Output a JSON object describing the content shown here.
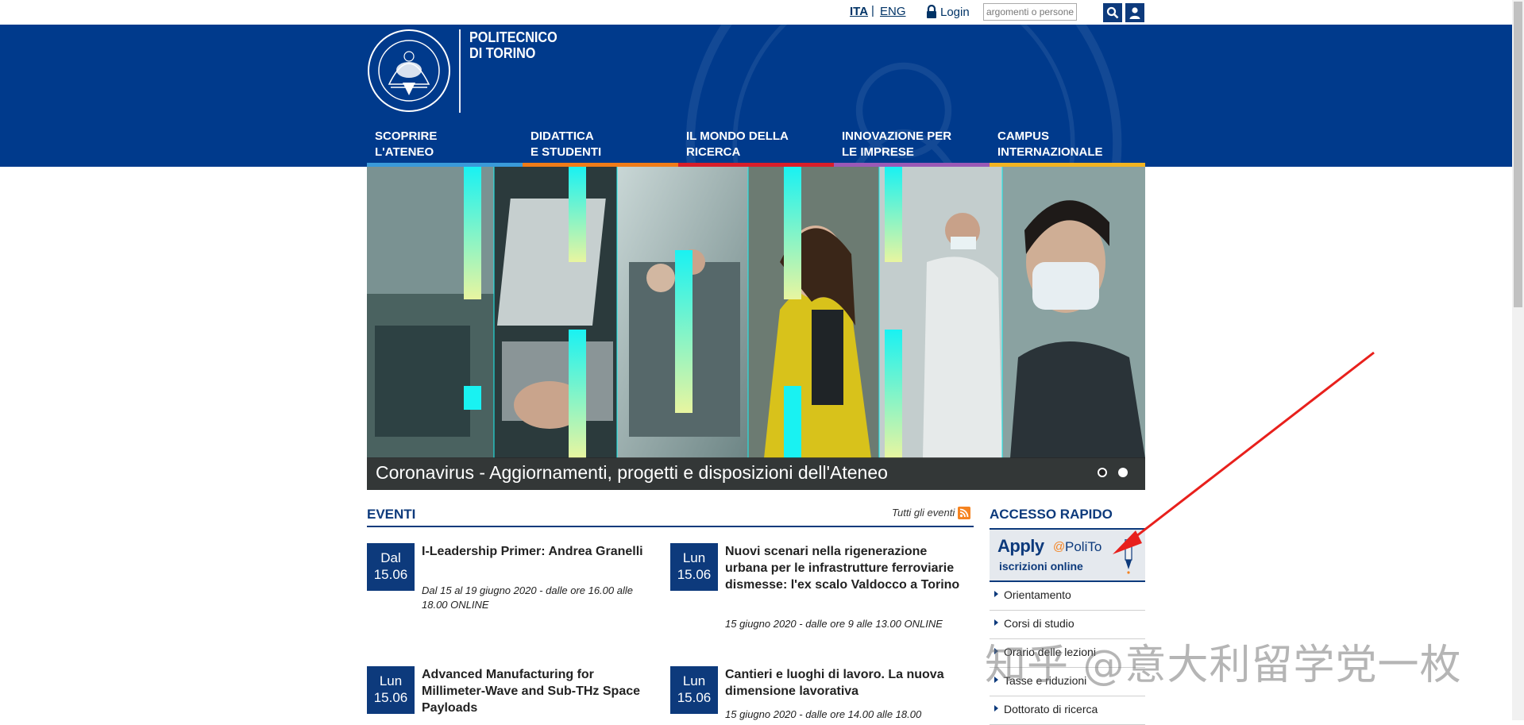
{
  "topbar": {
    "lang_ita": "ITA",
    "lang_separator": "|",
    "lang_eng": "ENG",
    "login_label": "Login",
    "search_placeholder": "argomenti o persone",
    "icons": [
      "lock-icon",
      "search-icon",
      "user-icon"
    ]
  },
  "header": {
    "logo_line1": "POLITECNICO",
    "logo_line2": "DI TORINO",
    "seal_text_top": "POLITECNICO DI TORINO",
    "seal_year_left": "1859",
    "seal_year_right": "1906",
    "background_color": "#003a8c",
    "nav": [
      {
        "label": "SCOPRIRE\nL'ATENEO",
        "color": "#3a9ad9"
      },
      {
        "label": "DIDATTICA\nE STUDENTI",
        "color": "#f07c18"
      },
      {
        "label": "IL MONDO DELLA\nRICERCA",
        "color": "#d91e2a"
      },
      {
        "label": "INNOVAZIONE PER\nLE IMPRESE",
        "color": "#9b59b6"
      },
      {
        "label": "CAMPUS\nINTERNAZIONALE",
        "color": "#f2b321"
      }
    ]
  },
  "slider": {
    "caption": "Coronavirus - Aggiornamenti, progetti e disposizioni dell'Ateneo",
    "slide_count": 2,
    "active_slide": 2
  },
  "events": {
    "title": "EVENTI",
    "all_link": "Tutti gli eventi",
    "items": [
      {
        "day": "Dal",
        "date": "15.06",
        "title": "I-Leadership Primer: Andrea Granelli",
        "details": "Dal 15 al 19 giugno 2020 - dalle ore 16.00 alle 18.00 ONLINE"
      },
      {
        "day": "Lun",
        "date": "15.06",
        "title": "Nuovi scenari nella rigenerazione urbana per le infrastrutture ferroviarie dismesse: l'ex scalo Valdocco a Torino",
        "details": "15 giugno 2020 - dalle ore 9 alle 13.00 ONLINE"
      },
      {
        "day": "Lun",
        "date": "15.06",
        "title": "Advanced Manufacturing for Millimeter-Wave and Sub-THz Space Payloads",
        "details": ""
      },
      {
        "day": "Lun",
        "date": "15.06",
        "title": "Cantieri e luoghi di lavoro. La nuova dimensione lavorativa",
        "details": "15 giugno 2020 - dalle ore 14.00 alle 18.00"
      }
    ]
  },
  "quick_access": {
    "title": "ACCESSO RAPIDO",
    "apply_word": "Apply",
    "apply_at": "@",
    "apply_polito": "PoliTo",
    "apply_sub": "iscrizioni online",
    "items": [
      "Orientamento",
      "Corsi di studio",
      "Orario delle lezioni",
      "Tasse e riduzioni",
      "Dottorato di ricerca"
    ]
  },
  "overlay": {
    "watermark_text": "知乎 @意大利留学党一枚",
    "arrow_color": "#e8201c"
  }
}
